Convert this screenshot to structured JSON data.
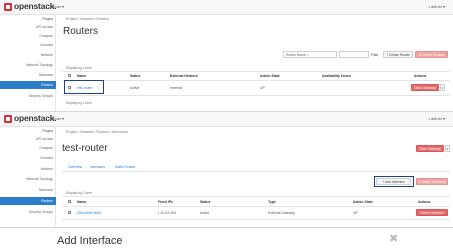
{
  "app": {
    "logo_text": "openstack.",
    "project_selector": "admin ▾",
    "user_menu": "• admin ▾"
  },
  "panel1": {
    "sidebar": [
      {
        "label": "Project",
        "state": "plain"
      },
      {
        "label": "API Access",
        "state": "normal"
      },
      {
        "label": "Compute",
        "state": "group"
      },
      {
        "label": "Volumes",
        "state": "group"
      },
      {
        "label": "Network",
        "state": "group"
      },
      {
        "label": "Network Topology",
        "state": "normal"
      },
      {
        "label": "Networks",
        "state": "normal"
      },
      {
        "label": "Routers",
        "state": "active"
      },
      {
        "label": "Security Groups",
        "state": "normal"
      }
    ],
    "breadcrumb": "Project / Network / Routers",
    "title": "Routers",
    "filter_select": "Router Name =",
    "filter_button": "Filter",
    "create_button": "+ Create Router",
    "delete_button": "✕ Delete Routers",
    "count_text": "Displaying 1 item",
    "columns": [
      "Name",
      "Status",
      "External Network",
      "Admin State",
      "Availability Zones",
      "Actions"
    ],
    "rows": [
      {
        "name": "test-router",
        "status": "Active",
        "external_network": "external",
        "admin_state": "UP",
        "availability_zones": "-",
        "action": "Clear Gateway"
      }
    ]
  },
  "panel2": {
    "sidebar": [
      {
        "label": "Project",
        "state": "plain"
      },
      {
        "label": "API Access",
        "state": "normal"
      },
      {
        "label": "Compute",
        "state": "group"
      },
      {
        "label": "Volumes",
        "state": "group"
      },
      {
        "label": "Network",
        "state": "group"
      },
      {
        "label": "Network Topology",
        "state": "normal"
      },
      {
        "label": "Networks",
        "state": "normal"
      },
      {
        "label": "Routers",
        "state": "active"
      },
      {
        "label": "Security Groups",
        "state": "normal"
      }
    ],
    "breadcrumb": "Project / Network / Routers / test-router",
    "title": "test-router",
    "clear_gateway_button": "Clear Gateway",
    "tabs": [
      "Overview",
      "Interfaces",
      "Static Routes"
    ],
    "add_interface_button": "+ Add Interface",
    "delete_interfaces_button": "✕ Delete Interfaces",
    "count_text": "Displaying 1 item",
    "columns": [
      "Name",
      "Fixed IPs",
      "Status",
      "Type",
      "Admin State",
      "Actions"
    ],
    "rows": [
      {
        "name": "(35cc3fdd-9bf0)",
        "fixed_ips": "• 10.0.0.254",
        "status": "Active",
        "type": "External Gateway",
        "admin_state": "UP",
        "action": "Delete Interface"
      }
    ]
  },
  "modal": {
    "title": "Add Interface",
    "close_icon": "✖"
  }
}
